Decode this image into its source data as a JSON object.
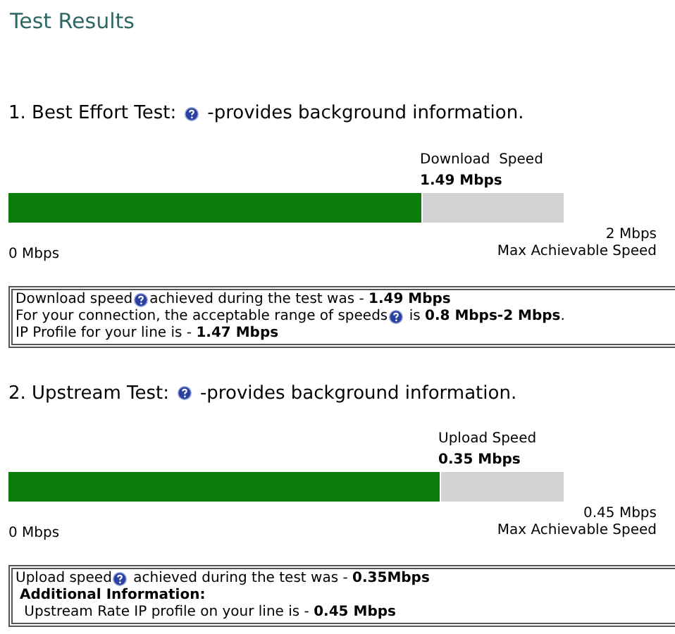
{
  "title": "Test Results",
  "tests": [
    {
      "heading": "1. Best Effort Test:",
      "heading_suffix": "-provides background information.",
      "speed_label": "Download  Speed",
      "speed_value": "1.49 Mbps",
      "level": 0.745,
      "min_label": "0 Mbps",
      "max_value": "2 Mbps",
      "max_label": "Max Achievable Speed",
      "info_lines": [
        {
          "kind": "text",
          "before": "Download speed",
          "help": true,
          "after": "achieved during the test was - **1.49 Mbps**"
        },
        {
          "kind": "text",
          "before": "For your connection, the acceptable range of speeds",
          "help": true,
          "after": " is **0.8 Mbps-2 Mbps**."
        },
        {
          "kind": "text",
          "before": "IP Profile for your line is - **1.47 Mbps**",
          "help": false
        }
      ]
    },
    {
      "heading": "2. Upstream Test:",
      "heading_suffix": "-provides background information.",
      "speed_label": "Upload Speed",
      "speed_value": "0.35 Mbps",
      "level": 0.778,
      "min_label": "0 Mbps",
      "max_value": "0.45 Mbps",
      "max_label": "Max Achievable Speed",
      "info_lines": [
        {
          "kind": "text",
          "before": "Upload speed",
          "help": true,
          "after": " achieved during the test was - **0.35Mbps**"
        },
        {
          "kind": "heading",
          "before": "Additional Information:",
          "help": false
        },
        {
          "kind": "text",
          "before": " Upstream Rate IP profile on your line is - **0.45 Mbps**",
          "help": false
        }
      ]
    }
  ]
}
